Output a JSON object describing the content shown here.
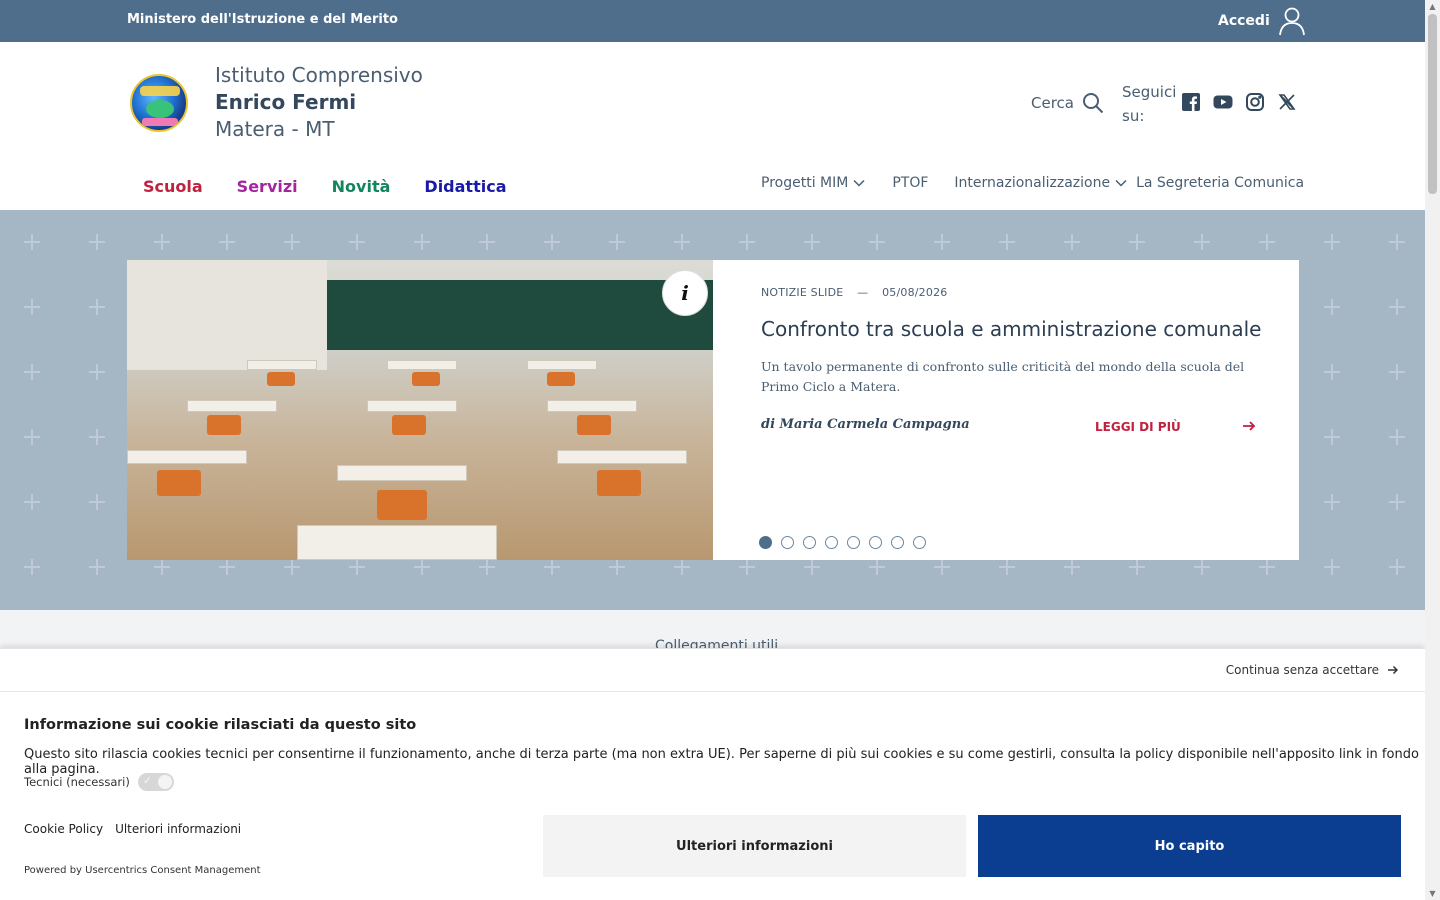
{
  "topbar": {
    "ministry": "Ministero dell'Istruzione e del Merito",
    "login_label": "Accedi"
  },
  "header": {
    "school_line1": "Istituto Comprensivo",
    "school_line2": "Enrico Fermi",
    "school_line3": "Matera - MT",
    "search_label": "Cerca",
    "follow_label": "Seguici su:",
    "socials": [
      "facebook-icon",
      "youtube-icon",
      "instagram-icon",
      "x-icon"
    ]
  },
  "mainnav": {
    "items": [
      {
        "label": "Scuola",
        "color": "#c0213f"
      },
      {
        "label": "Servizi",
        "color": "#a4269f"
      },
      {
        "label": "Novità",
        "color": "#12855e"
      },
      {
        "label": "Didattica",
        "color": "#1a1aa8"
      }
    ]
  },
  "subnav": {
    "items": [
      {
        "label": "Progetti MIM",
        "dropdown": true
      },
      {
        "label": "PTOF",
        "dropdown": false
      },
      {
        "label": "Internazionalizzazione",
        "dropdown": true
      },
      {
        "label": "La Segreteria Comunica",
        "dropdown": false
      }
    ]
  },
  "slide": {
    "category": "NOTIZIE SLIDE",
    "date": "05/08/2026",
    "title": "Confronto tra scuola e amministrazione comunale",
    "text": "Un tavolo permanente di confronto sulle criticità del mondo della scuola del Primo Ciclo a Matera.",
    "author": "di Maria Carmela Campagna",
    "read_more": "LEGGI DI PIÙ",
    "info_label": "i",
    "dots_total": 8,
    "dots_active": 1
  },
  "links_band": {
    "title": "Collegamenti utili"
  },
  "cookie": {
    "skip_label": "Continua senza accettare",
    "title": "Informazione sui cookie rilasciati da questo sito",
    "text": "Questo sito rilascia cookies tecnici per consentirne il funzionamento, anche di terza parte (ma non extra UE). Per saperne di più sui cookies e su come gestirli, consulta la policy disponibile nell'apposito link in fondo alla pagina.",
    "technical_label": "Tecnici (necessari)",
    "policy_link": "Cookie Policy",
    "more_link": "Ulteriori informazioni",
    "powered": "Powered by Usercentrics Consent Management",
    "btn_more": "Ulteriori informazioni",
    "btn_ok": "Ho capito"
  },
  "colors": {
    "topbar": "#4e6e8c",
    "hero": "#6b87a0",
    "accent_red": "#c0213f",
    "primary_button": "#0b3d91"
  }
}
